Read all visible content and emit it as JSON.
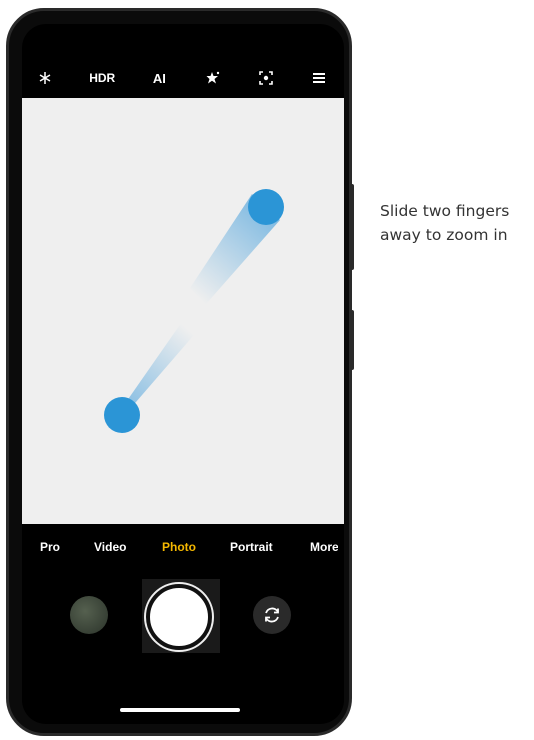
{
  "top_bar": {
    "flash_icon": "flash-off-icon",
    "hdr_label": "HDR",
    "ai_label": "AI",
    "effects_icon": "beauty-effects-icon",
    "lens_icon": "lens-focus-icon",
    "menu_icon": "menu-icon"
  },
  "gesture": {
    "dot_color": "#2b95d6",
    "instruction_line1": "Slide two fingers",
    "instruction_line2": "away to zoom in"
  },
  "modes": [
    {
      "label": "Pro"
    },
    {
      "label": "Video"
    },
    {
      "label": "Photo",
      "active": true
    },
    {
      "label": "Portrait"
    },
    {
      "label": "More"
    }
  ],
  "colors": {
    "active_mode": "#f5b800",
    "viewfinder_bg": "#efefef"
  },
  "controls": {
    "gallery_icon": "gallery-thumbnail",
    "shutter_icon": "shutter-button",
    "switch_icon": "switch-camera-icon"
  }
}
